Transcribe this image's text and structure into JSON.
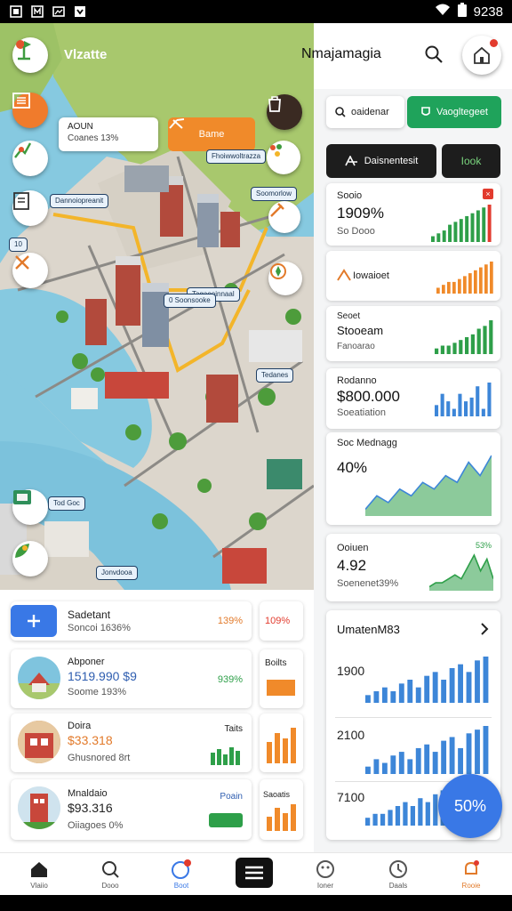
{
  "status_bar": {
    "time": "9238",
    "icons": [
      "photo-icon",
      "note-icon",
      "image-icon",
      "download-icon"
    ]
  },
  "header": {
    "logo_text": "Vlzatte",
    "title": "Nmajamagia"
  },
  "map": {
    "info_card": {
      "line1": "AOUN",
      "line2": "Coanes 13%"
    },
    "orange_pill_label": "Bame",
    "tags": [
      "Dannoiopreanit",
      "Fhoiwwoltrazza",
      "Soomorlow",
      "Tagaoeinnaal",
      "0 Soonsooke",
      "Tedanes",
      "Tod Goc",
      "Jonvdooa",
      "10"
    ]
  },
  "search": {
    "left_label": "oaidenar",
    "right_label": "Vaogltegeet"
  },
  "buttons": {
    "dark_label": "Daisnentesit",
    "dark2_label": "Iook"
  },
  "cards": [
    {
      "title": "Sooio",
      "value": "1909%",
      "sub": "So Dooo"
    },
    {
      "title": "Iowaioet"
    },
    {
      "title": "Seoet",
      "value": "Stooeam",
      "sub": "Fanoarao"
    },
    {
      "title": "Rodanno",
      "value": "$800.000",
      "sub": "Soeatiation"
    },
    {
      "title": "Soc Mednagg",
      "value": "40%"
    },
    {
      "title": "Ooiuen",
      "value": "4.92",
      "sub": "Soenenet39%",
      "badge": "53%"
    },
    {
      "title": "UmatenM83"
    }
  ],
  "chart_data": [
    {
      "type": "bar",
      "title": "Sooio",
      "values": [
        2,
        3,
        4,
        6,
        7,
        8,
        9,
        10,
        11,
        12,
        13
      ]
    },
    {
      "type": "bar",
      "title": "Iowaioet",
      "values": [
        2,
        3,
        4,
        4,
        5,
        6,
        7,
        8,
        9,
        10,
        11
      ]
    },
    {
      "type": "bar",
      "title": "Seoet",
      "values": [
        2,
        3,
        3,
        4,
        5,
        6,
        7,
        9,
        10,
        12
      ]
    },
    {
      "type": "bar",
      "title": "Rodanno",
      "values": [
        3,
        6,
        4,
        2,
        6,
        4,
        5,
        8,
        2,
        9
      ]
    },
    {
      "type": "area",
      "title": "Soc Mednagg",
      "values": [
        1,
        3,
        2,
        4,
        3,
        5,
        4,
        6,
        5,
        8,
        6,
        9
      ]
    },
    {
      "type": "area",
      "title": "Ooiuen",
      "values": [
        1,
        2,
        2,
        3,
        4,
        3,
        6,
        9,
        5,
        8,
        3
      ]
    },
    {
      "type": "bar",
      "label": "1900",
      "values": [
        2,
        3,
        4,
        3,
        5,
        6,
        4,
        7,
        8,
        6,
        9,
        10,
        8,
        11,
        12
      ]
    },
    {
      "type": "bar",
      "label": "2100",
      "values": [
        2,
        4,
        3,
        5,
        6,
        4,
        7,
        8,
        6,
        9,
        10,
        7,
        11,
        12,
        13
      ]
    },
    {
      "type": "bar",
      "label": "7100",
      "values": [
        2,
        3,
        3,
        4,
        5,
        6,
        5,
        7,
        6,
        8,
        9,
        8,
        10
      ]
    }
  ],
  "list": [
    {
      "title": "Sadetant",
      "sub": "Soncoi 1636%",
      "pct": "139%",
      "side": "109%"
    },
    {
      "title": "Abponer",
      "value": "1519.990 $9",
      "sub": "Soome 193%",
      "pct": "939%",
      "side": "Boilts"
    },
    {
      "title": "Doira",
      "value": "$33.318",
      "sub": "Ghusnored 8rt",
      "pct": "Taits"
    },
    {
      "title": "Mnaldaio",
      "value": "$93.316",
      "sub": "Oiiagoes 0%",
      "pct": "Poain",
      "side": "Saoatis"
    }
  ],
  "fab_label": "50%",
  "bottom_nav": [
    "Vlaiio",
    "Dooo",
    "Boot",
    "",
    "Ioner",
    "Daals",
    "Rooie"
  ]
}
